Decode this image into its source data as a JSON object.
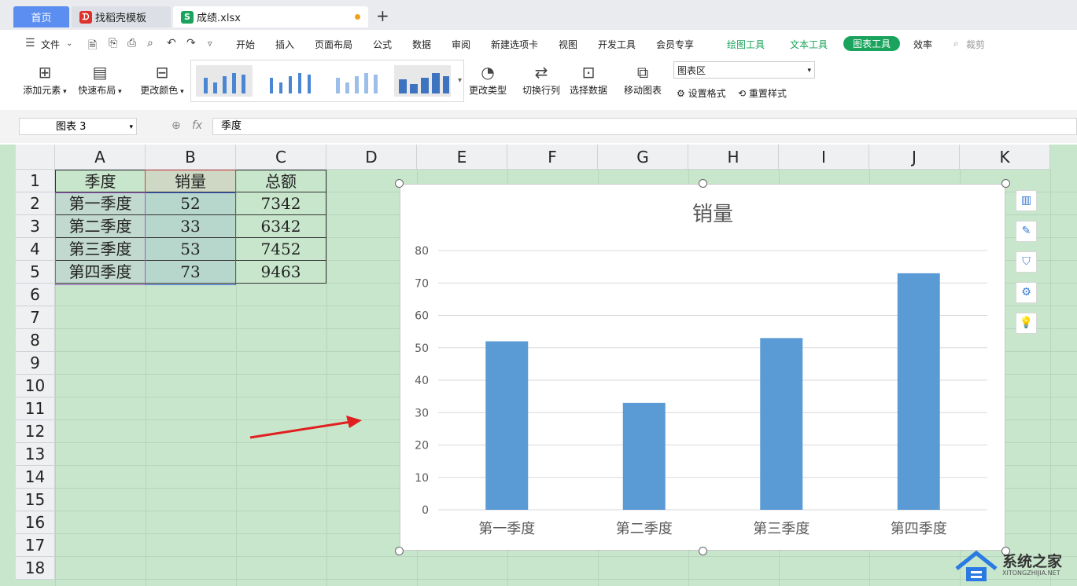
{
  "tabs": [
    {
      "label": "首页"
    },
    {
      "label": "找稻壳模板"
    },
    {
      "label": "成绩.xlsx"
    }
  ],
  "menu": {
    "file": "文件",
    "items": [
      "开始",
      "插入",
      "页面布局",
      "公式",
      "数据",
      "审阅",
      "新建选项卡",
      "视图",
      "开发工具",
      "会员专享"
    ],
    "tool_tabs": [
      "绘图工具",
      "文本工具",
      "图表工具"
    ],
    "efficiency": "效率",
    "search": "裁剪"
  },
  "ribbon": {
    "add_element": "添加元素",
    "quick_layout": "快速布局",
    "change_color": "更改颜色",
    "change_type": "更改类型",
    "switch_rowcol": "切换行列",
    "select_data": "选择数据",
    "move_chart": "移动图表",
    "chart_area": "图表区",
    "set_format": "设置格式",
    "reset_style": "重置样式"
  },
  "formula": {
    "name_box": "图表 3",
    "fx": "fx",
    "value": "季度"
  },
  "columns": [
    "A",
    "B",
    "C",
    "D",
    "E",
    "F",
    "G",
    "H",
    "I",
    "J",
    "K"
  ],
  "rows": [
    "1",
    "2",
    "3",
    "4",
    "5",
    "6",
    "7",
    "8",
    "9",
    "10",
    "11",
    "12",
    "13",
    "14",
    "15",
    "16",
    "17",
    "18"
  ],
  "table": [
    [
      "季度",
      "销量",
      "总额"
    ],
    [
      "第一季度",
      "52",
      "7342"
    ],
    [
      "第二季度",
      "33",
      "6342"
    ],
    [
      "第三季度",
      "53",
      "7452"
    ],
    [
      "第四季度",
      "73",
      "9463"
    ]
  ],
  "colors": {
    "bar": "#5b9bd5",
    "sheet_bg": "#c8e6cc",
    "accent": "#1aa35c",
    "arrow": "#e02020"
  },
  "chart_data": {
    "type": "bar",
    "title": "销量",
    "categories": [
      "第一季度",
      "第二季度",
      "第三季度",
      "第四季度"
    ],
    "values": [
      52,
      33,
      53,
      73
    ],
    "ylim": [
      0,
      80
    ],
    "yticks": [
      0,
      10,
      20,
      30,
      40,
      50,
      60,
      70,
      80
    ],
    "grid": true
  },
  "watermark": {
    "name": "系统之家",
    "url": "XITONGZHIJIA.NET"
  }
}
